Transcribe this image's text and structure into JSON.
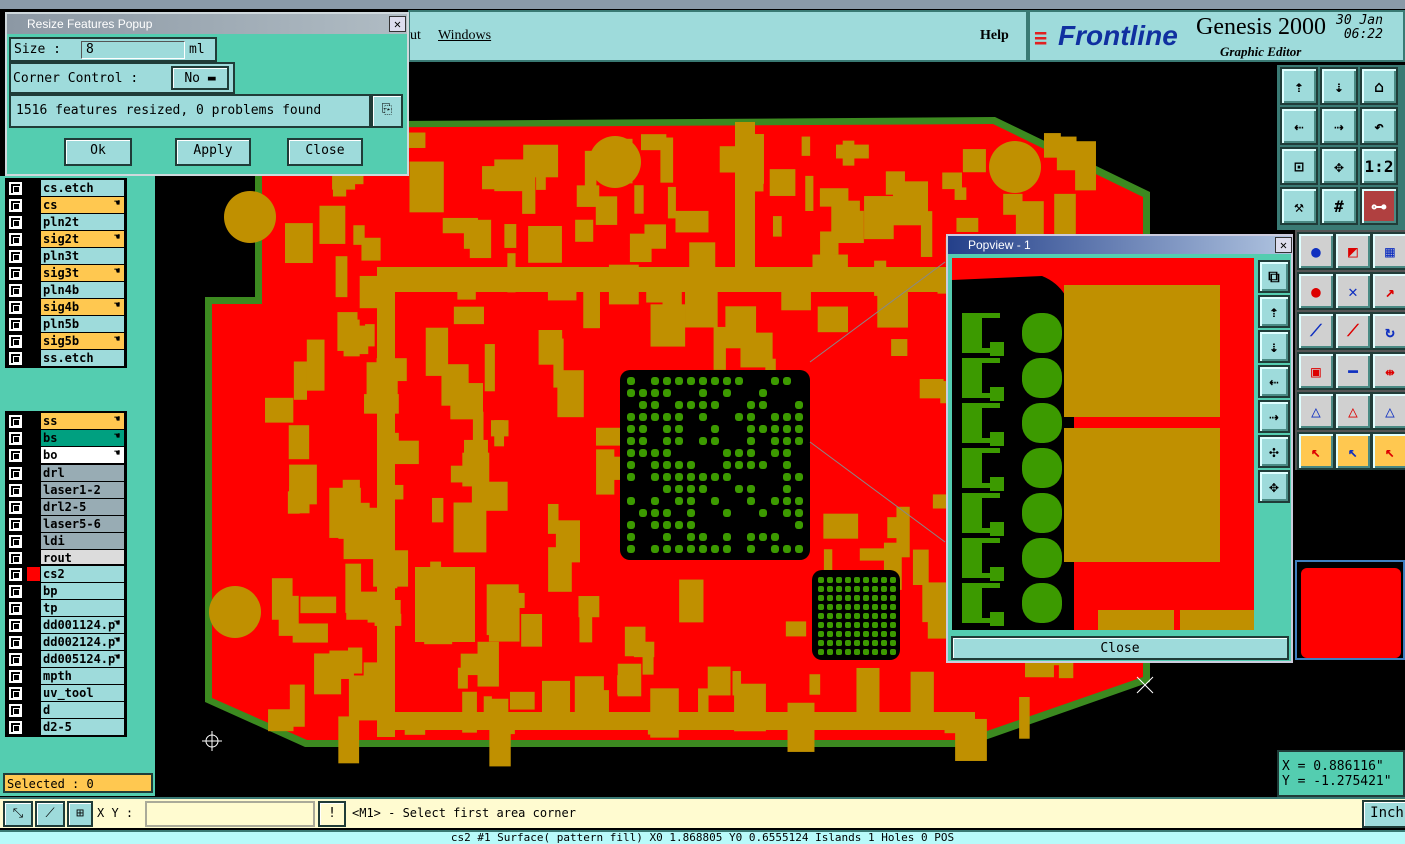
{
  "colors": {
    "panel": "#54cdb0",
    "field": "#9edbdb",
    "copper": "#ff0000",
    "pad": "#c09000",
    "drill": "#3c9a00"
  },
  "menubar": {
    "items": [
      "ut",
      "Windows"
    ],
    "help": "Help"
  },
  "logo": {
    "brand": "Frontline",
    "product": "Genesis 2000",
    "subtitle": "Graphic Editor",
    "date": "30 Jan",
    "time": "06:22"
  },
  "resize_popup": {
    "title": "Resize Features Popup",
    "size_label": "Size :",
    "size_value": "8",
    "size_unit": "ml",
    "corner_label": "Corner Control :",
    "corner_value": "No",
    "message": "1516 features resized, 0 problems found",
    "ok": "Ok",
    "apply": "Apply",
    "close": "Close"
  },
  "layers": {
    "group1": [
      {
        "name": "cs.etch",
        "color": "#9edbdb"
      },
      {
        "name": "cs",
        "color": "#ffc850",
        "hand": true
      },
      {
        "name": "pln2t",
        "color": "#9edbdb"
      },
      {
        "name": "sig2t",
        "color": "#ffc850",
        "hand": true
      },
      {
        "name": "pln3t",
        "color": "#9edbdb"
      },
      {
        "name": "sig3t",
        "color": "#ffc850",
        "hand": true
      },
      {
        "name": "pln4b",
        "color": "#9edbdb"
      },
      {
        "name": "sig4b",
        "color": "#ffc850",
        "hand": true
      },
      {
        "name": "pln5b",
        "color": "#9edbdb"
      },
      {
        "name": "sig5b",
        "color": "#ffc850",
        "hand": true
      },
      {
        "name": "ss.etch",
        "color": "#9edbdb"
      }
    ],
    "group2": [
      {
        "name": "ss",
        "color": "#ffc850",
        "hand": true
      },
      {
        "name": "bs",
        "color": "#00a080",
        "hand": true
      },
      {
        "name": "bo",
        "color": "#ffffff",
        "hand": true
      }
    ],
    "group3": [
      {
        "name": "drl",
        "color": "#98acb4"
      },
      {
        "name": "laser1-2",
        "color": "#98acb4"
      },
      {
        "name": "drl2-5",
        "color": "#98acb4"
      },
      {
        "name": "laser5-6",
        "color": "#98acb4"
      },
      {
        "name": "ldi",
        "color": "#98acb4"
      },
      {
        "name": "rout",
        "color": "#dcdcdc"
      }
    ],
    "group4": [
      {
        "name": "cs2",
        "color": "#9edbdb",
        "active": "#ff0000"
      },
      {
        "name": "bp",
        "color": "#9edbdb"
      },
      {
        "name": "tp",
        "color": "#9edbdb"
      },
      {
        "name": "dd001124.p",
        "color": "#9edbdb",
        "hand": true
      },
      {
        "name": "dd002124.p",
        "color": "#9edbdb",
        "hand": true
      },
      {
        "name": "dd005124.p",
        "color": "#9edbdb",
        "hand": true
      },
      {
        "name": "mpth",
        "color": "#9edbdb"
      },
      {
        "name": "uv_tool",
        "color": "#9edbdb"
      },
      {
        "name": "d",
        "color": "#9edbdb"
      },
      {
        "name": "d2-5",
        "color": "#9edbdb"
      }
    ]
  },
  "selected": "Selected : 0",
  "toolbar": {
    "icons": [
      "zoom-up-icon",
      "zoom-down-icon",
      "home-icon",
      "pan-left-icon",
      "pan-right-icon",
      "undo-view-icon",
      "fit-icon",
      "center-icon",
      "scale-1-2-icon",
      "tools-icon",
      "grid-icon",
      "netlist-icon"
    ],
    "scale_label": "1:2"
  },
  "popview": {
    "title": "Popview - 1",
    "close": "Close"
  },
  "coords": {
    "x": "X = 0.886116\"",
    "y": "Y = -1.275421\""
  },
  "cmdbar": {
    "xy_label": "X Y :",
    "xy_value": "",
    "prompt": "<M1> - Select first area corner",
    "units": "Inch"
  },
  "status": "cs2 #1 Surface( pattern fill) X0 1.868805 Y0 0.6555124 Islands 1 Holes 0 POS"
}
